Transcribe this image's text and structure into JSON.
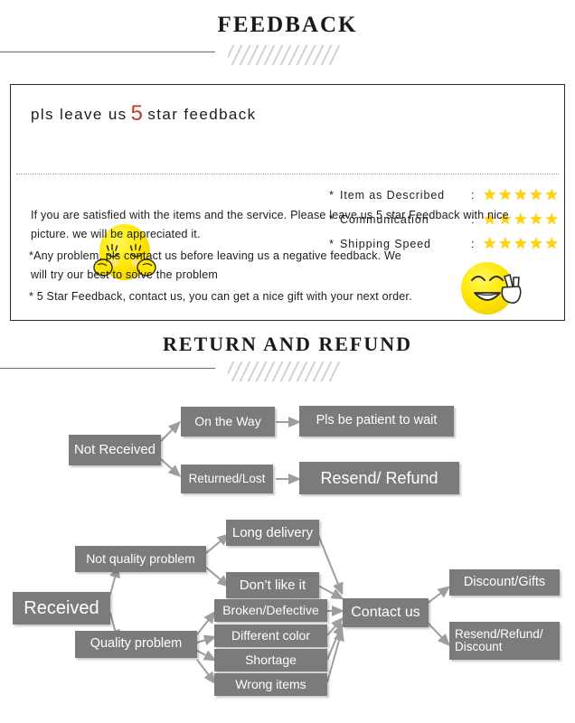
{
  "sections": {
    "feedback_title": "FEEDBACK",
    "return_title": "RETURN AND REFUND"
  },
  "feedback": {
    "headline_before": "pls leave us",
    "headline_number": "5",
    "headline_after": "star feedback",
    "ratings": [
      {
        "bullet": "*",
        "label": "Item as Described",
        "colon": ":",
        "stars": 5
      },
      {
        "bullet": "*",
        "label": "Communication",
        "colon": ":",
        "stars": 5
      },
      {
        "bullet": "*",
        "label": "Shipping Speed",
        "colon": ":",
        "stars": 5
      }
    ],
    "star_glyph": "★",
    "star_color": "#ffd400",
    "paragraphs": [
      "If you are satisfied with the items and the service. Please leave us 5 star Feedback with nice",
      "picture. we will be appreciated it.",
      "*Any problem, pls contact us before leaving us a negative feedback. We",
      "will try our best to solve   the problem",
      "* 5 Star Feedback, contact us, you can get a nice gift with your next order."
    ],
    "emoji_left": "shy-face-hands-on-cheeks-emoji",
    "emoji_right": "smiling-face-peace-sign-emoji"
  },
  "flowchart": {
    "box_color": "#7b7b7b",
    "text_color": "#ffffff",
    "nodes": [
      {
        "id": "not-received",
        "label": "Not Received"
      },
      {
        "id": "on-the-way",
        "label": "On the Way"
      },
      {
        "id": "pls-be-patient",
        "label": "Pls be patient to wait"
      },
      {
        "id": "returned-lost",
        "label": "Returned/Lost"
      },
      {
        "id": "resend-refund",
        "label": "Resend/ Refund"
      },
      {
        "id": "received",
        "label": "Received"
      },
      {
        "id": "not-quality",
        "label": "Not quality problem"
      },
      {
        "id": "long-delivery",
        "label": "Long delivery"
      },
      {
        "id": "dont-like-it",
        "label": "Don’t like it"
      },
      {
        "id": "quality-problem",
        "label": "Quality problem"
      },
      {
        "id": "broken",
        "label": "Broken/Defective"
      },
      {
        "id": "different-color",
        "label": "Different color"
      },
      {
        "id": "shortage",
        "label": "Shortage"
      },
      {
        "id": "wrong-items",
        "label": "Wrong items"
      },
      {
        "id": "contact-us",
        "label": "Contact us"
      },
      {
        "id": "discount-gifts",
        "label": "Discount/Gifts"
      },
      {
        "id": "resend-refund-discount",
        "label": "Resend/Refund/ Discount"
      }
    ]
  }
}
